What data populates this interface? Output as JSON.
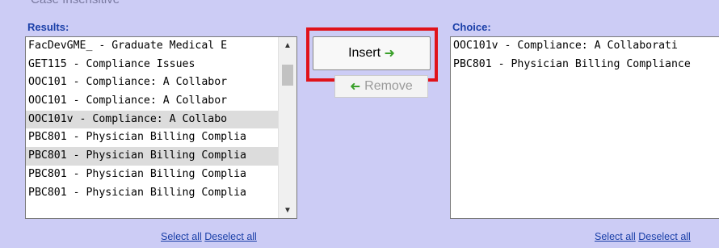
{
  "header": {
    "partial_text": "Case Insensitive"
  },
  "results": {
    "label": "Results:",
    "items": [
      {
        "text": "FacDevGME_ - Graduate Medical E",
        "selected": false
      },
      {
        "text": "GET115 - Compliance Issues",
        "selected": false
      },
      {
        "text": "OOC101 - Compliance: A Collabor",
        "selected": false
      },
      {
        "text": "OOC101 - Compliance: A Collabor",
        "selected": false
      },
      {
        "text": "OOC101v - Compliance: A Collabo",
        "selected": true
      },
      {
        "text": "PBC801 - Physician Billing Complia",
        "selected": false
      },
      {
        "text": "PBC801 - Physician Billing Complia",
        "selected": true
      },
      {
        "text": "PBC801 - Physician Billing Complia",
        "selected": false
      },
      {
        "text": "PBC801 - Physician Billing Complia",
        "selected": false
      }
    ],
    "select_all": "Select all",
    "deselect_all": "Deselect all"
  },
  "buttons": {
    "insert_label": "Insert",
    "remove_label": "Remove",
    "insert_icon": "green-right-arrow",
    "remove_icon": "green-left-arrow"
  },
  "choice": {
    "label": "Choice:",
    "items": [
      {
        "text": "OOC101v - Compliance: A Collaborati"
      },
      {
        "text": "PBC801 - Physician Billing Compliance"
      }
    ],
    "select_all": "Select all",
    "deselect_all": "Deselect all"
  },
  "colors": {
    "background": "#ccccf5",
    "highlight": "#e0121a",
    "link": "#1a3fa8",
    "arrow": "#3aa02a"
  }
}
